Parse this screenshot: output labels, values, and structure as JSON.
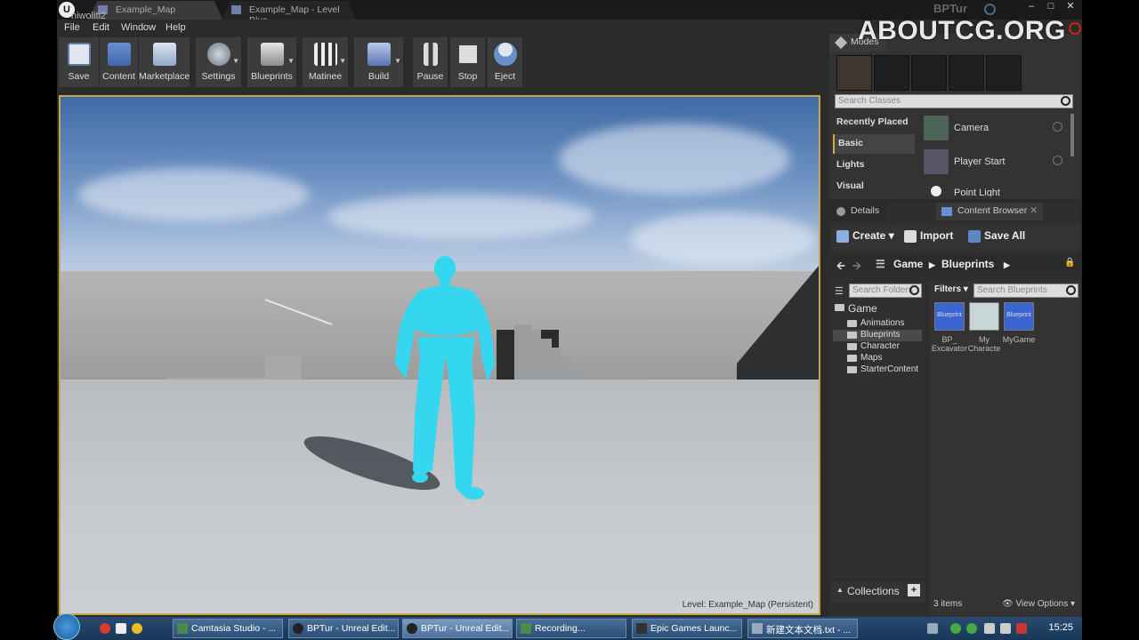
{
  "titlebar": {
    "user": "niwoliti2",
    "tabs": [
      {
        "label": "Example_Map"
      },
      {
        "label": "Example_Map - Level Blue"
      }
    ],
    "project": "BPTur",
    "watermark": "ABOUTCG.ORG"
  },
  "menu": [
    "File",
    "Edit",
    "Window",
    "Help"
  ],
  "toolbar": {
    "buttons": [
      "Save",
      "Content",
      "Marketplace",
      "Settings",
      "Blueprints",
      "Matinee",
      "Build",
      "Pause",
      "Stop",
      "Eject"
    ]
  },
  "viewport": {
    "level_prefix": "Level:",
    "level_name": "Example_Map (Persistent)"
  },
  "modes": {
    "tab": "Modes",
    "search_placeholder": "Search Classes",
    "categories": [
      "Recently Placed",
      "Basic",
      "Lights",
      "Visual"
    ],
    "items": [
      "Camera",
      "Player Start",
      "Point Light"
    ]
  },
  "content_browser": {
    "tabs": [
      "Details",
      "Content Browser"
    ],
    "create": "Create",
    "import": "Import",
    "save_all": "Save All",
    "path": [
      "Game",
      "Blueprints"
    ],
    "folder_search": "Search Folders",
    "filters": "Filters",
    "asset_search": "Search Blueprints",
    "tree": [
      "Game",
      "Animations",
      "Blueprints",
      "Character",
      "Maps",
      "StarterContent"
    ],
    "assets": [
      {
        "tile": "Blueprint",
        "label": "BP_ Excavator"
      },
      {
        "tile": "",
        "label": "My Characte"
      },
      {
        "tile": "Blueprint",
        "label": "MyGame"
      }
    ],
    "collections": "Collections",
    "count": "3 items",
    "view_options": "View Options"
  },
  "taskbar": {
    "tasks": [
      "Camtasia Studio - ...",
      "BPTur - Unreal Edit...",
      "BPTur - Unreal Edit...",
      "Recording...",
      "Epic Games Launc...",
      "新建文本文档.txt - ..."
    ],
    "clock": "15:25"
  },
  "colors": {
    "accent": "#e4a23c",
    "viewport_border": "#c8a44a",
    "character": "#34d6f0"
  }
}
